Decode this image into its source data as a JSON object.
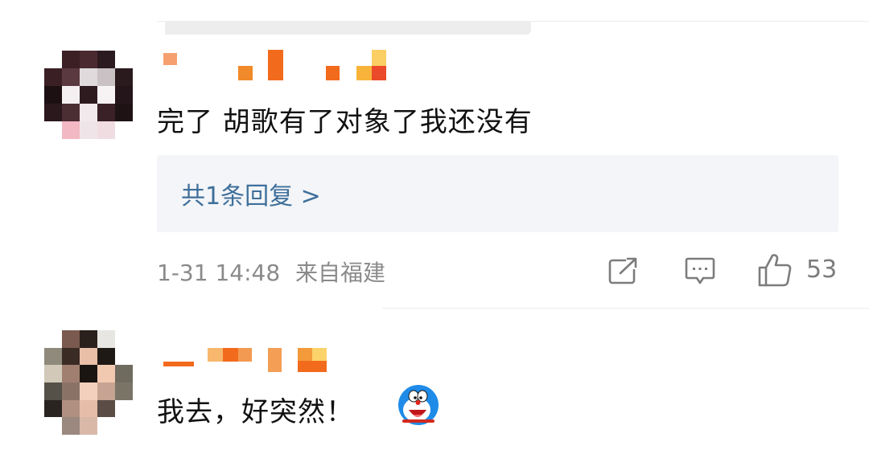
{
  "comments": [
    {
      "text": "完了 胡歌有了对象了我还没有",
      "reply_link": "共1条回复 >",
      "timestamp": "1-31 14:48",
      "location": "来自福建",
      "like_count": "53"
    },
    {
      "text": "我去，好突然！",
      "emoji": "doraemon-emoji"
    }
  ],
  "colors": {
    "reply_link": "#3f6f9a",
    "meta_text": "#8a8a8a",
    "reply_box_bg": "#f3f5f8",
    "username_orange": "#f26b1d"
  },
  "icons": [
    "share-icon",
    "comment-icon",
    "like-icon"
  ]
}
